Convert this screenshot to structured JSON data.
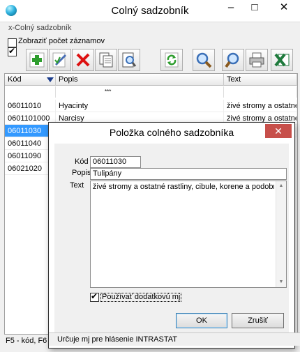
{
  "main_window": {
    "title": "Colný sadzobník",
    "minimize": "–",
    "maximize": "□",
    "close": "✕",
    "form_caption": "x-Colný sadzobník",
    "show_count_label": "Zobraziť počet záznamov",
    "show_count_checked": false,
    "second_checkbox_checked": true,
    "toolbar": [
      {
        "name": "add-record-button",
        "icon": "plus-icon"
      },
      {
        "name": "edit-record-button",
        "icon": "edit-pencil-icon"
      },
      {
        "name": "delete-record-button",
        "icon": "red-x-icon"
      },
      {
        "name": "copy-record-button",
        "icon": "copy-pages-icon"
      },
      {
        "name": "view-record-button",
        "icon": "document-magnifier-icon"
      },
      {
        "name": "refresh-button",
        "icon": "refresh-arrows-icon"
      },
      {
        "name": "find-button",
        "icon": "magnifier-icon"
      },
      {
        "name": "find-next-button",
        "icon": "magnifier-icon"
      },
      {
        "name": "print-button",
        "icon": "printer-icon"
      },
      {
        "name": "export-excel-button",
        "icon": "excel-icon"
      }
    ],
    "grid": {
      "columns": [
        "Kód",
        "Popis",
        "Text"
      ],
      "filter_placeholder": "***",
      "rows": [
        {
          "kod": "06011010",
          "popis": "Hyacinty",
          "text": "živé stromy a ostatné"
        },
        {
          "kod": "0601101000",
          "popis": "Narcisy",
          "text": "živé stromy a ostatné"
        },
        {
          "kod": "06011030",
          "popis": "",
          "text": ""
        },
        {
          "kod": "06011040",
          "popis": "",
          "text": ""
        },
        {
          "kod": "06011090",
          "popis": "",
          "text": ""
        },
        {
          "kod": "06021020",
          "popis": "",
          "text": ""
        }
      ],
      "selected_index": 2
    },
    "status_text": "F5 - kód, F6"
  },
  "dialog": {
    "title": "Položka colného sadzobníka",
    "close": "✕",
    "kod_label": "Kód",
    "kod_value": "06011030",
    "popis_label": "Popis",
    "popis_value": "Tulipány",
    "text_label": "Text",
    "text_value": "živé stromy a ostatné rastliny, cibule, korene a podobné",
    "use_unit_label": "Používať dodatkovú mj",
    "use_unit_checked": true,
    "ok_label": "OK",
    "cancel_label": "Zrušiť",
    "status_text": "Určuje mj pre hlásenie INTRASTAT"
  },
  "colors": {
    "selection": "#3399ff",
    "close_button": "#c74f4a",
    "excel_green": "#1e7a3c"
  }
}
